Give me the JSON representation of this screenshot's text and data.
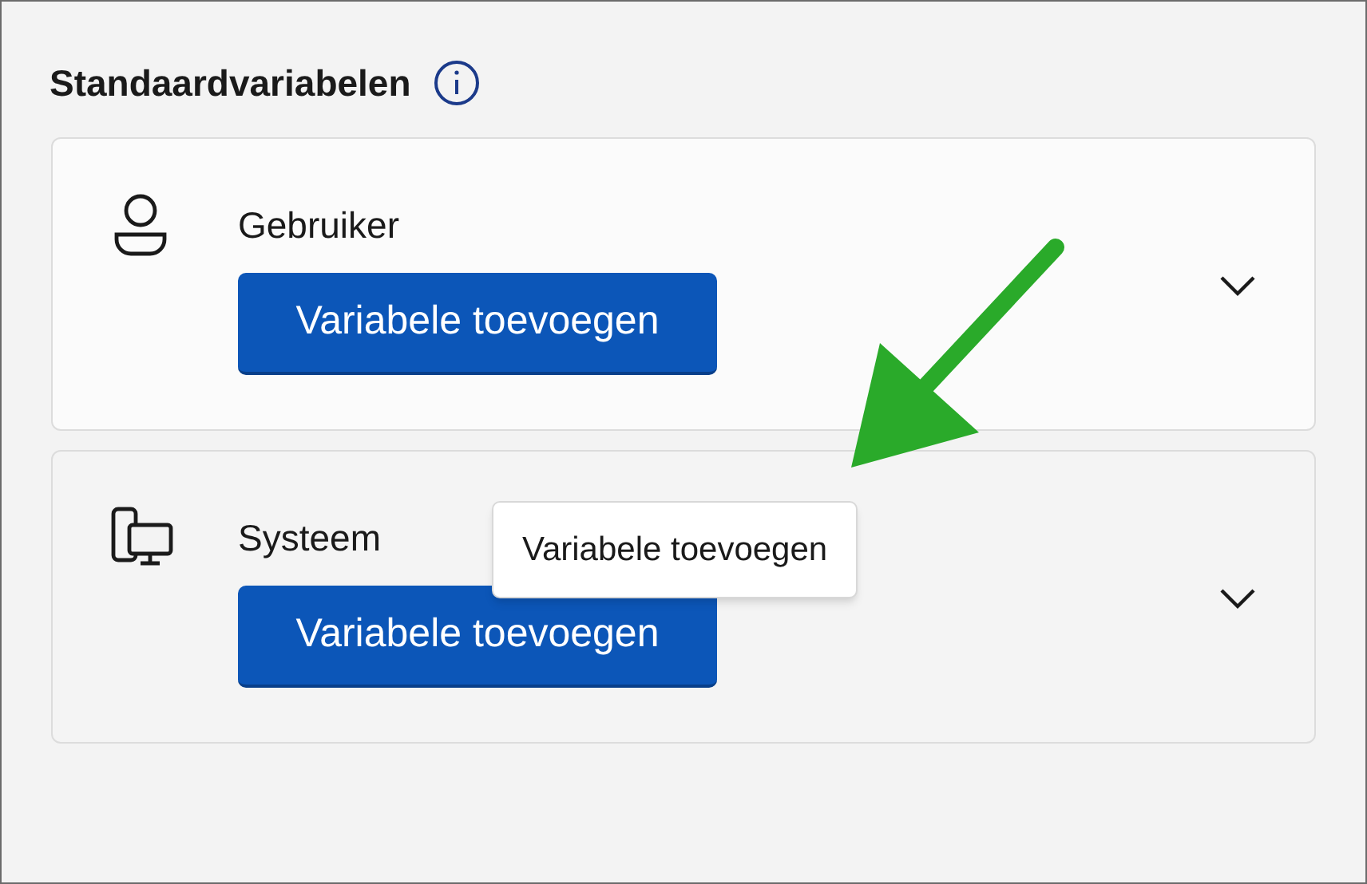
{
  "heading": "Standaardvariabelen",
  "sections": [
    {
      "kind": "user",
      "label": "Gebruiker",
      "button": "Variabele toevoegen"
    },
    {
      "kind": "system",
      "label": "Systeem",
      "button": "Variabele toevoegen"
    }
  ],
  "tooltip": {
    "text": "Variabele toevoegen"
  }
}
